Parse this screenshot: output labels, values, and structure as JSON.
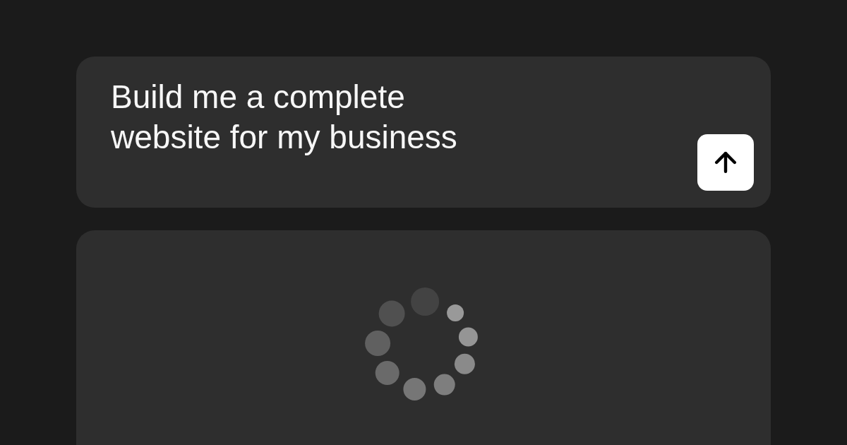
{
  "prompt": {
    "value": "Build me a complete website for my business"
  },
  "send_button": {
    "disabled": false
  },
  "preview": {
    "loading": true
  }
}
